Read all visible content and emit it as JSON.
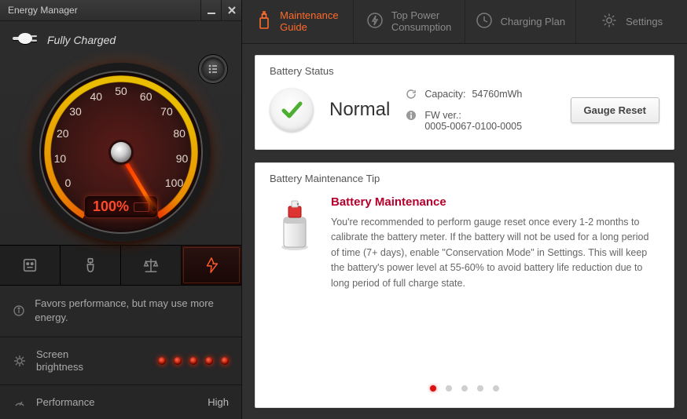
{
  "window": {
    "title": "Energy Manager"
  },
  "charge": {
    "status_text": "Fully Charged",
    "percent_label": "100%"
  },
  "gauge": {
    "ticks": [
      "0",
      "10",
      "20",
      "30",
      "40",
      "50",
      "60",
      "70",
      "80",
      "90",
      "100"
    ],
    "value": 100
  },
  "mode": {
    "active_index": 3,
    "description": "Favors performance, but may use more energy."
  },
  "brightness": {
    "label": "Screen brightness",
    "level": 5,
    "max": 5
  },
  "performance": {
    "label": "Performance",
    "value": "High"
  },
  "tabs": [
    {
      "label": "Maintenance\nGuide",
      "icon": "spray-can-icon"
    },
    {
      "label": "Top Power\nConsumption",
      "icon": "bolt-icon"
    },
    {
      "label": "Charging Plan",
      "icon": "clock-icon"
    },
    {
      "label": "Settings",
      "icon": "gear-icon"
    }
  ],
  "active_tab": 0,
  "battery_status": {
    "heading": "Battery Status",
    "state": "Normal",
    "capacity_label": "Capacity:",
    "capacity_value": "54760mWh",
    "fw_label": "FW ver.:",
    "fw_value": "0005-0067-0100-0005",
    "button": "Gauge Reset"
  },
  "tip": {
    "heading": "Battery Maintenance Tip",
    "title": "Battery Maintenance",
    "body": "You're recommended to perform gauge reset once every 1-2 months to calibrate the battery meter. If the battery will not be used for a long period of time (7+ days), enable \"Conservation Mode\" in Settings. This will keep the battery's power level at 55-60% to avoid battery life reduction due to long period of full charge state.",
    "page_count": 5,
    "page_index": 0
  },
  "colors": {
    "accent": "#ff6a2a",
    "danger_text": "#b3002d"
  }
}
